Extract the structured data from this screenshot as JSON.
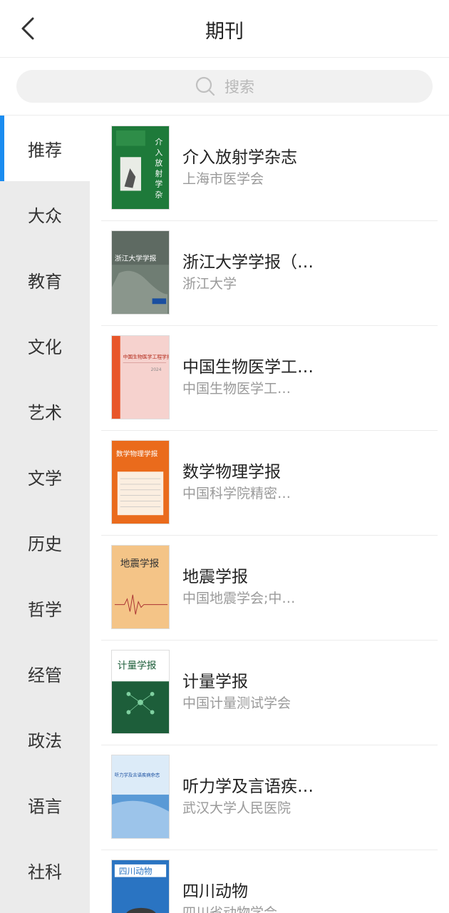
{
  "header": {
    "title": "期刊"
  },
  "search": {
    "placeholder": "搜索"
  },
  "sidebar": {
    "items": [
      {
        "label": "推荐",
        "active": true
      },
      {
        "label": "大众"
      },
      {
        "label": "教育"
      },
      {
        "label": "文化"
      },
      {
        "label": "艺术"
      },
      {
        "label": "文学"
      },
      {
        "label": "历史"
      },
      {
        "label": "哲学"
      },
      {
        "label": "经管"
      },
      {
        "label": "政法"
      },
      {
        "label": "语言"
      },
      {
        "label": "社科"
      }
    ]
  },
  "journals": [
    {
      "title": "介入放射学杂志",
      "publisher": "上海市医学会",
      "cover_color": "#1e7a3a",
      "cover_text": "介入放射学杂志"
    },
    {
      "title": "浙江大学学报（…",
      "publisher": "浙江大学",
      "cover_color": "#6f7d73",
      "cover_text": "浙江大学学报"
    },
    {
      "title": "中国生物医学工…",
      "publisher": "中国生物医学工…",
      "cover_color": "#f6d2ce",
      "cover_text": "中国生物医学工程学报"
    },
    {
      "title": "数学物理学报",
      "publisher": "中国科学院精密…",
      "cover_color": "#ea6b1c",
      "cover_text": "数学物理学报"
    },
    {
      "title": "地震学报",
      "publisher": "中国地震学会;中…",
      "cover_color": "#f4c487",
      "cover_text": "地震学报"
    },
    {
      "title": "计量学报",
      "publisher": "中国计量测试学会",
      "cover_color": "#1d5e3a",
      "cover_text": "计量学报"
    },
    {
      "title": "听力学及言语疾…",
      "publisher": "武汉大学人民医院",
      "cover_color": "#5a9ad6",
      "cover_text": "听力学及言语疾病杂志"
    },
    {
      "title": "四川动物",
      "publisher": "四川省动物学会",
      "cover_color": "#2a74c2",
      "cover_text": "四川动物"
    }
  ],
  "colors": {
    "accent": "#1a8cf0",
    "sidebar_bg": "#ebebeb"
  }
}
